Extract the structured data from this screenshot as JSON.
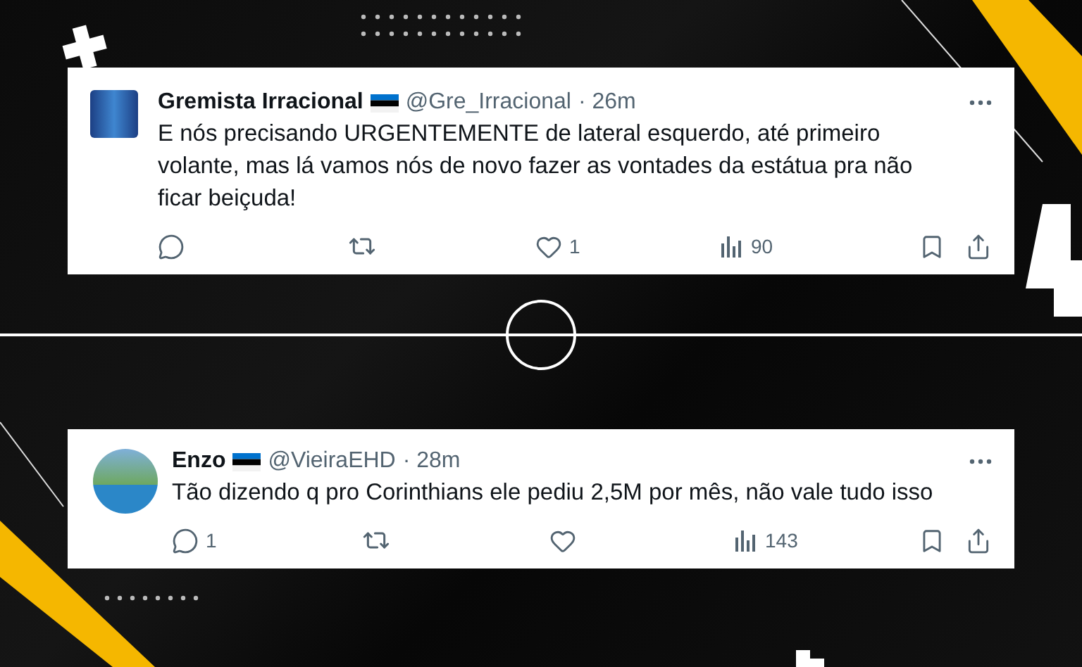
{
  "tweets": [
    {
      "name": "Gremista Irracional",
      "handle": "@Gre_Irracional",
      "time": "· 26m",
      "kind": "square",
      "text": "E nós precisando URGENTEMENTE de lateral esquerdo, até primeiro volante, mas lá vamos nós de novo fazer as vontades da estátua pra não ficar beiçuda!",
      "likes": "1",
      "views": "90"
    },
    {
      "name": "Enzo",
      "handle": "@VieiraEHD",
      "time": "· 28m",
      "kind": "round",
      "text": "Tão dizendo q pro Corinthians ele pediu 2,5M por mês, não vale tudo isso",
      "replies": "1",
      "views": "143"
    }
  ]
}
